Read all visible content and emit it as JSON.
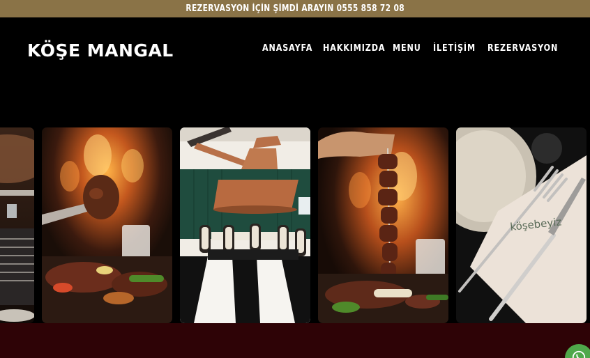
{
  "topbar": {
    "text": "REZERVASYON İÇİN ŞİMDİ ARAYIN 0555 858 72 08"
  },
  "header": {
    "logo": "KÖŞE MANGAL",
    "nav": [
      {
        "label": "ANASAYFA"
      },
      {
        "label": "HAKKIMIZDA"
      },
      {
        "label": "MENU"
      },
      {
        "label": "İLETİŞİM"
      },
      {
        "label": "REZERVASYON"
      }
    ]
  },
  "gallery": {
    "napkin_text": "köşebeyiz"
  },
  "colors": {
    "topbar": "#8a7347",
    "footer": "#2e0306",
    "whatsapp": "#4fa84a"
  }
}
